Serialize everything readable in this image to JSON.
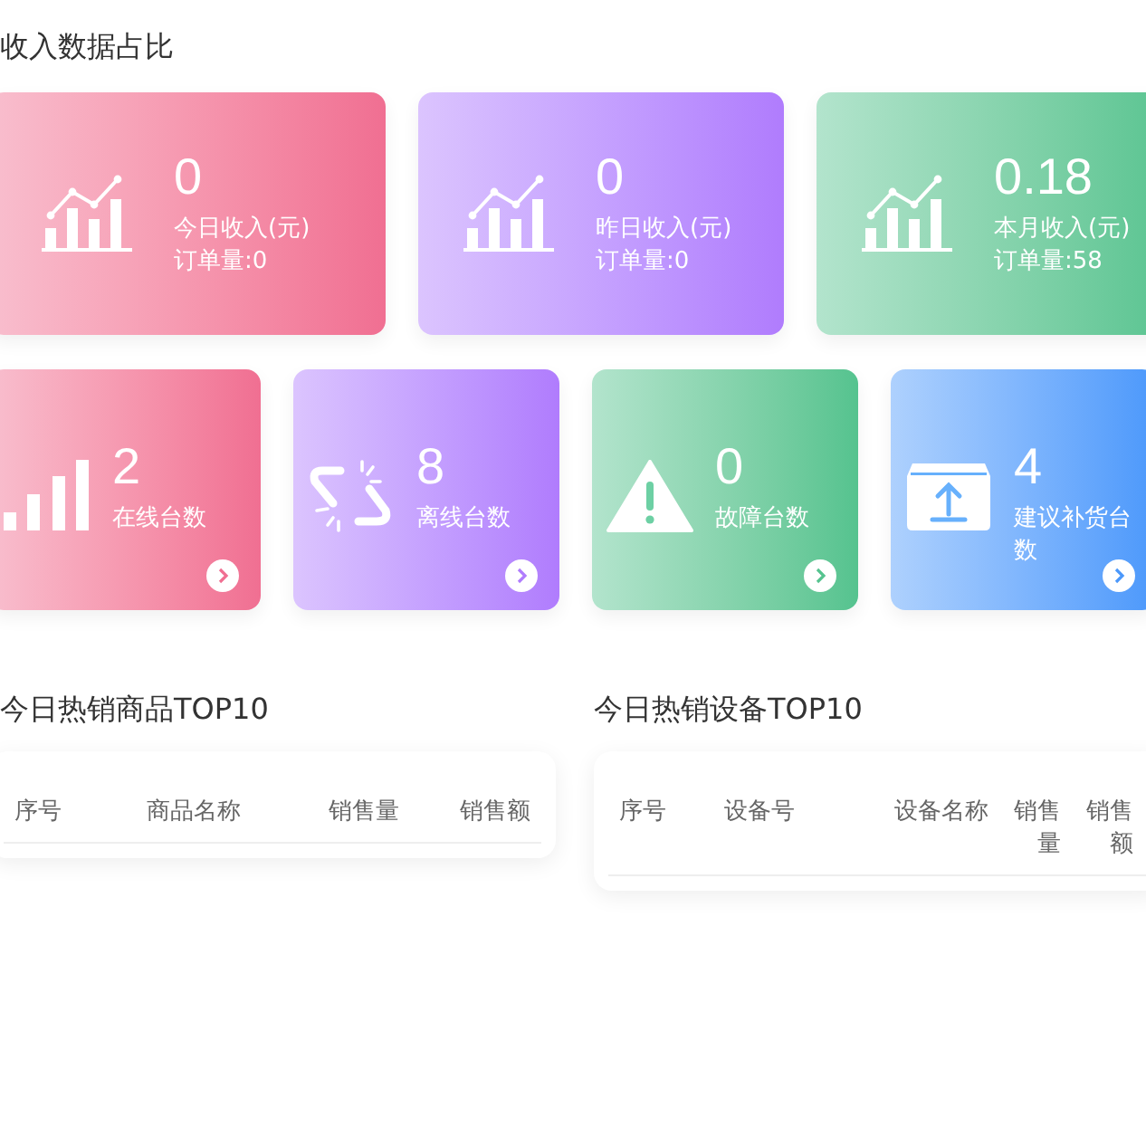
{
  "section_title": "收入数据占比",
  "income_cards": [
    {
      "value": "0",
      "label": "今日收入(元)",
      "orders": "订单量:0",
      "color": "#f06f92"
    },
    {
      "value": "0",
      "label": "昨日收入(元)",
      "orders": "订单量:0",
      "color": "#b07cfd"
    },
    {
      "value": "0.18",
      "label": "本月收入(元)",
      "orders": "订单量:58",
      "color": "#55c38f"
    }
  ],
  "device_cards": [
    {
      "kind": "signal",
      "value": "2",
      "label": "在线台数",
      "color": "#f06f92"
    },
    {
      "kind": "broken-link",
      "value": "8",
      "label": "离线台数",
      "color": "#b07cfd"
    },
    {
      "kind": "warning",
      "value": "0",
      "label": "故障台数",
      "color": "#55c38f"
    },
    {
      "kind": "restock",
      "value": "4",
      "label": "建议补货台数",
      "color": "#4b98fb"
    }
  ],
  "tables": [
    {
      "title": "今日热销商品TOP10",
      "columns": [
        "序号",
        "商品名称",
        "销售量",
        "销售额"
      ]
    },
    {
      "title": "今日热销设备TOP10",
      "columns": [
        "序号",
        "设备号",
        "设备名称",
        "销售量",
        "销售额"
      ]
    }
  ]
}
